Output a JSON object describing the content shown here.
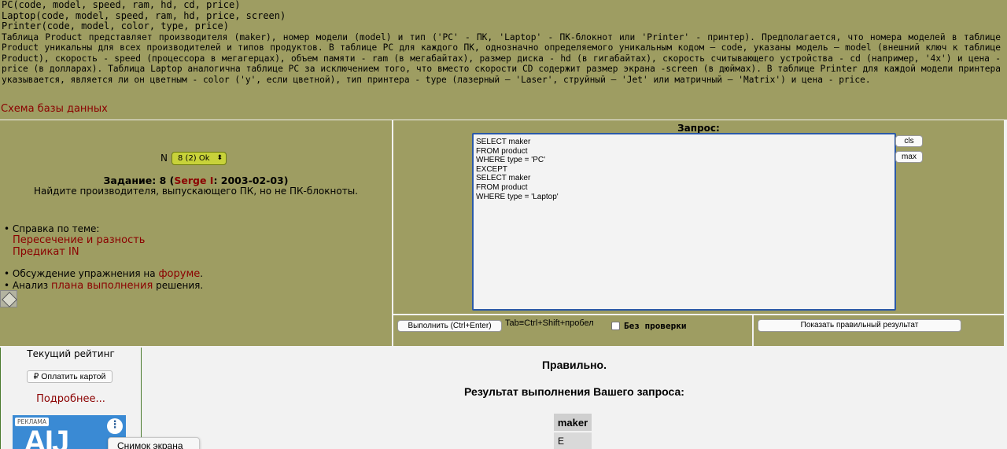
{
  "schema_lines": [
    "PC(code, model, speed, ram, hd, cd, price)",
    "Laptop(code, model, speed, ram, hd, price, screen)",
    "Printer(code, model, color, type, price)"
  ],
  "description": "Таблица Product представляет производителя (maker), номер модели (model) и тип ('PC' - ПК, 'Laptop' - ПК-блокнот или 'Printer' - принтер). Предполагается, что номера моделей в таблице Product уникальны для всех производителей и типов продуктов. В таблице PC для каждого ПК, однозначно определяемого уникальным кодом – code, указаны модель – model (внешний ключ к таблице Product), скорость - speed (процессора в мегагерцах), объем памяти - ram (в мегабайтах), размер диска - hd (в гигабайтах), скорость считывающего устройства - cd (например, '4x') и цена - price (в долларах). Таблица Laptop аналогична таблице PC за исключением того, что вместо скорости CD содержит размер экрана -screen (в дюймах). В таблице Printer для каждой модели принтера указывается, является ли он цветным - color ('y', если цветной), тип принтера - type (лазерный – 'Laser', струйный – 'Jet' или матричный – 'Matrix') и цена - price.",
  "schema_link": "Схема базы данных",
  "task": {
    "n_label": "N",
    "n_value": "8 (2) Ok",
    "title_prefix": "Задание: 8 (",
    "author": "Serge I",
    "title_suffix": ": 2003-02-03)",
    "text": "Найдите производителя, выпускающего ПК, но не ПК-блокноты."
  },
  "help": {
    "topic_label": "Справка по теме:",
    "link1": "Пересечение и разность",
    "link2": "Предикат IN",
    "forum_prefix": "Обсуждение упражнения на ",
    "forum_link": "форуме",
    "forum_suffix": ".",
    "plan_prefix": "Анализ ",
    "plan_link": "плана выполнения",
    "plan_suffix": " решения."
  },
  "query": {
    "label": "Запрос:",
    "sql": "SELECT maker\nFROM product\nWHERE type = 'PC'\nEXCEPT\nSELECT maker\nFROM product\nWHERE type = 'Laptop'",
    "cls": "cls",
    "max": "max",
    "run": "Выполнить (Ctrl+Enter)",
    "tab_hint": "Tab≡Ctrl+Shift+пробел",
    "no_check": "Без проверки",
    "show_correct": "Показать правильный результат"
  },
  "sidebar": {
    "rating": "Текущий рейтинг",
    "pay": "₽ Оплатить картой",
    "more": "Подробнее...",
    "ad_tag": "РЕКЛАМА",
    "ad_logo": "AIJ"
  },
  "tooltip": "Снимок экрана",
  "result": {
    "correct": "Правильно.",
    "title": "Результат выполнения Вашего запроса:",
    "column": "maker",
    "rows": [
      "E"
    ]
  }
}
